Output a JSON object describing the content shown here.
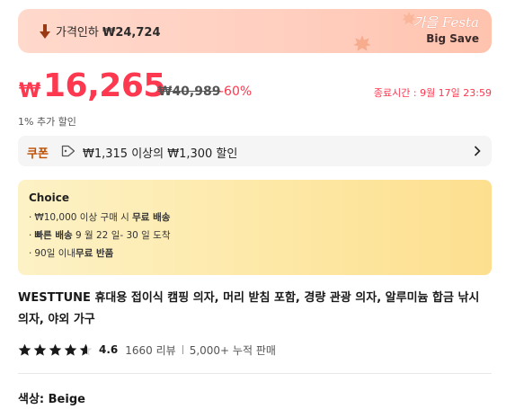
{
  "banner": {
    "drop_label": "가격인하",
    "drop_price": "₩24,724",
    "festa_title": "가을 Festa",
    "big_save": "Big Save",
    "icon": "price-drop-icon",
    "colors": {
      "bg_start": "#ffd9cc",
      "bg_end": "#ffc3ae"
    }
  },
  "price": {
    "currency": "₩",
    "current": "16,265",
    "original": "₩40,989",
    "discount": "-60%",
    "deadline": "종료시간 : 9월 17일 23:59",
    "accent_color": "#fd384f"
  },
  "extra_discount": "1% 추가 할인",
  "coupon": {
    "label": "쿠폰",
    "text": "₩1,315 이상의 ₩1,300 할인",
    "icon": "tag-icon"
  },
  "choice": {
    "title": "Choice",
    "items": [
      {
        "prefix": "₩10,000 이상 구매 시 ",
        "bold": "무료 배송",
        "suffix": ""
      },
      {
        "prefix": "",
        "bold": "빠른 배송",
        "suffix": " 9 월 22 일- 30 일 도착"
      },
      {
        "prefix": "90일 이내",
        "bold": "무료 반품",
        "suffix": ""
      }
    ]
  },
  "product": {
    "title": "WESTTUNE 휴대용 접이식 캠핑 의자, 머리 받침 포함, 경량 관광 의자, 알루미늄 합금 낚시 의자, 야외 가구",
    "rating": "4.6",
    "rating_value": 4.6,
    "reviews": "1660 리뷰",
    "sold": "5,000+ 누적 판매"
  },
  "color_selection": "색상: Beige"
}
